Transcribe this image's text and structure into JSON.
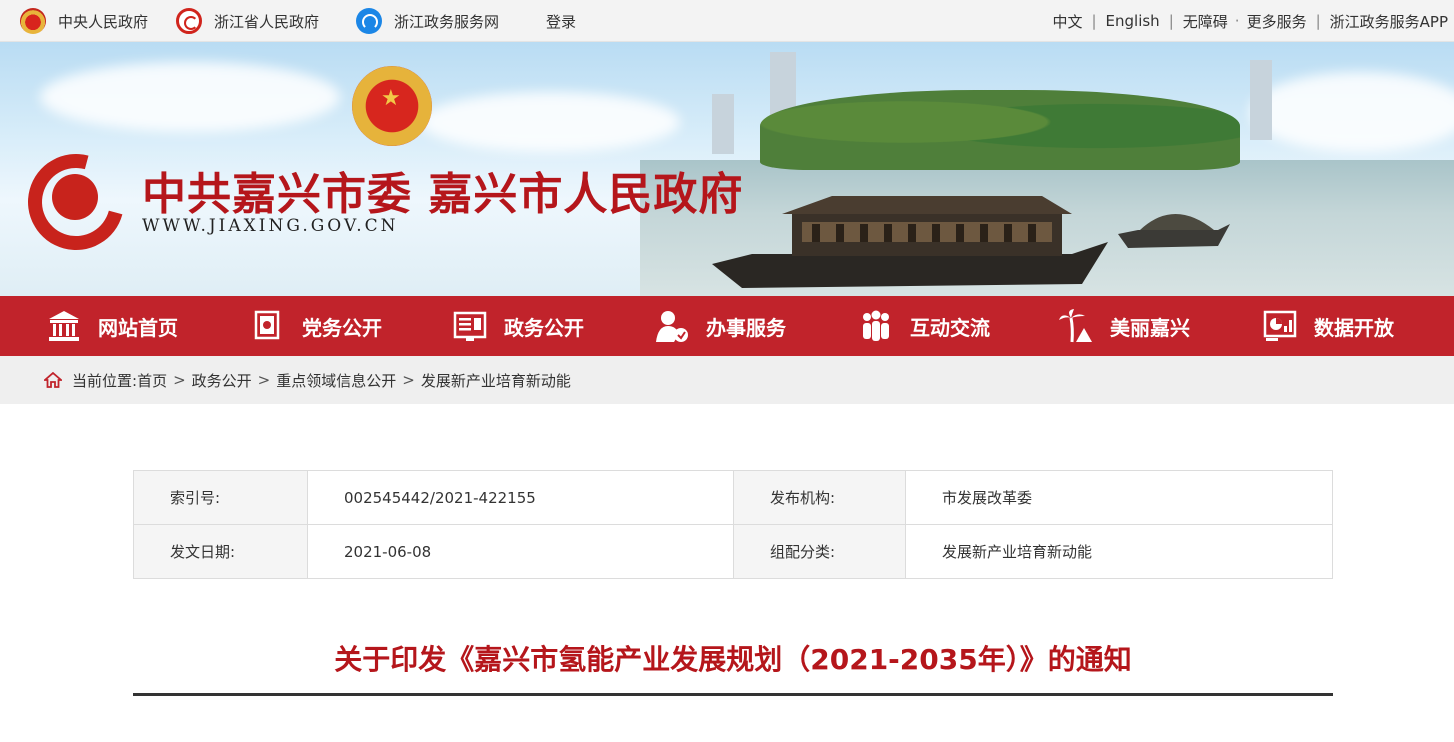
{
  "topbar": {
    "links": [
      {
        "label": "中央人民政府",
        "icon": "national-emblem-icon"
      },
      {
        "label": "浙江省人民政府",
        "icon": "zhejiang-gov-icon"
      },
      {
        "label": "浙江政务服务网",
        "icon": "zwfw-icon"
      },
      {
        "label": "登录"
      }
    ],
    "right": [
      "中文",
      "English",
      "无障碍",
      "更多服务",
      "浙江政务服务APP"
    ]
  },
  "banner": {
    "title": "中共嘉兴市委 嘉兴市人民政府",
    "url": "WWW.JIAXING.GOV.CN"
  },
  "nav": [
    {
      "label": "网站首页",
      "icon": "government-building-icon"
    },
    {
      "label": "党务公开",
      "icon": "party-flag-icon"
    },
    {
      "label": "政务公开",
      "icon": "document-board-icon"
    },
    {
      "label": "办事服务",
      "icon": "service-person-icon"
    },
    {
      "label": "互动交流",
      "icon": "people-group-icon"
    },
    {
      "label": "美丽嘉兴",
      "icon": "palm-tree-icon"
    },
    {
      "label": "数据开放",
      "icon": "data-chart-icon"
    }
  ],
  "breadcrumb": {
    "prefix": "当前位置:",
    "items": [
      "首页",
      "政务公开",
      "重点领域信息公开",
      "发展新产业培育新动能"
    ],
    "separator": ">"
  },
  "info": {
    "index_label": "索引号:",
    "index_value": "002545442/2021-422155",
    "org_label": "发布机构:",
    "org_value": "市发展改革委",
    "date_label": "发文日期:",
    "date_value": "2021-06-08",
    "category_label": "组配分类:",
    "category_value": "发展新产业培育新动能"
  },
  "document": {
    "title": "关于印发《嘉兴市氢能产业发展规划（2021-2035年）》的通知"
  },
  "colors": {
    "brand_red": "#c1232b",
    "title_red": "#b5161b",
    "topbar_bg": "#f3f3f3"
  }
}
